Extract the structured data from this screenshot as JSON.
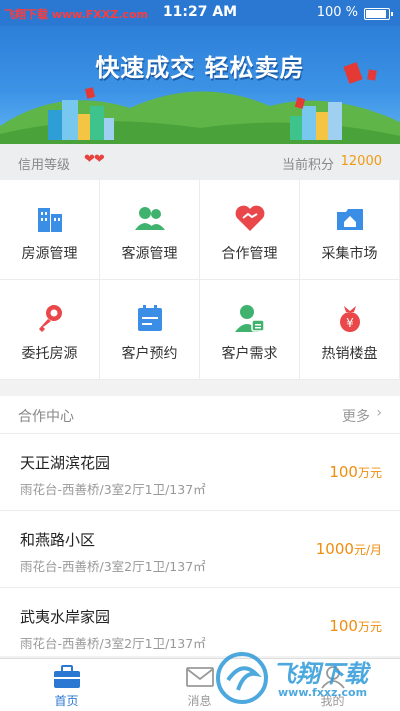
{
  "status_bar": {
    "watermark": "飞翔下载 www.FXXZ.com",
    "time": "11:27 AM",
    "battery": "100 %",
    "battery_level": 1.0
  },
  "banner": {
    "slogan": "快速成交 轻松卖房"
  },
  "info_bar": {
    "credit_label": "信用等级",
    "hearts": "❤❤",
    "points_label": "当前积分",
    "points_value": "12000"
  },
  "grid": {
    "items": [
      {
        "label": "房源管理",
        "icon": "building-icon",
        "color": "#3a8ee6"
      },
      {
        "label": "客源管理",
        "icon": "customers-icon",
        "color": "#3fb36e"
      },
      {
        "label": "合作管理",
        "icon": "handshake-heart-icon",
        "color": "#e9474a"
      },
      {
        "label": "采集市场",
        "icon": "home-folder-icon",
        "color": "#3a8ee6"
      },
      {
        "label": "委托房源",
        "icon": "key-icon",
        "color": "#e9474a"
      },
      {
        "label": "客户预约",
        "icon": "calendar-icon",
        "color": "#3a8ee6"
      },
      {
        "label": "客户需求",
        "icon": "user-card-icon",
        "color": "#3fb36e"
      },
      {
        "label": "热销楼盘",
        "icon": "money-bag-icon",
        "color": "#e9474a"
      }
    ]
  },
  "cooperation": {
    "title": "合作中心",
    "more": "更多",
    "items": [
      {
        "name": "天正湖滨花园",
        "detail": "雨花台-西善桥/3室2厅1卫/137㎡",
        "price": "100",
        "unit": "万元"
      },
      {
        "name": "和燕路小区",
        "detail": "雨花台-西善桥/3室2厅1卫/137㎡",
        "price": "1000",
        "unit": "元/月"
      },
      {
        "name": "武夷水岸家园",
        "detail": "雨花台-西善桥/3室2厅1卫/137㎡",
        "price": "100",
        "unit": "万元"
      }
    ]
  },
  "tabbar": {
    "tabs": [
      {
        "label": "首页",
        "icon": "briefcase-icon",
        "active": true
      },
      {
        "label": "消息",
        "icon": "envelope-icon",
        "active": false
      },
      {
        "label": "我的",
        "icon": "person-icon",
        "active": false
      }
    ]
  },
  "watermark_bottom": {
    "main": "飞翔下载",
    "url": "www.fxxz.com"
  },
  "colors": {
    "brand_blue": "#2a78d2",
    "price_orange": "#f08c0e",
    "heart_red": "#e8413e"
  }
}
